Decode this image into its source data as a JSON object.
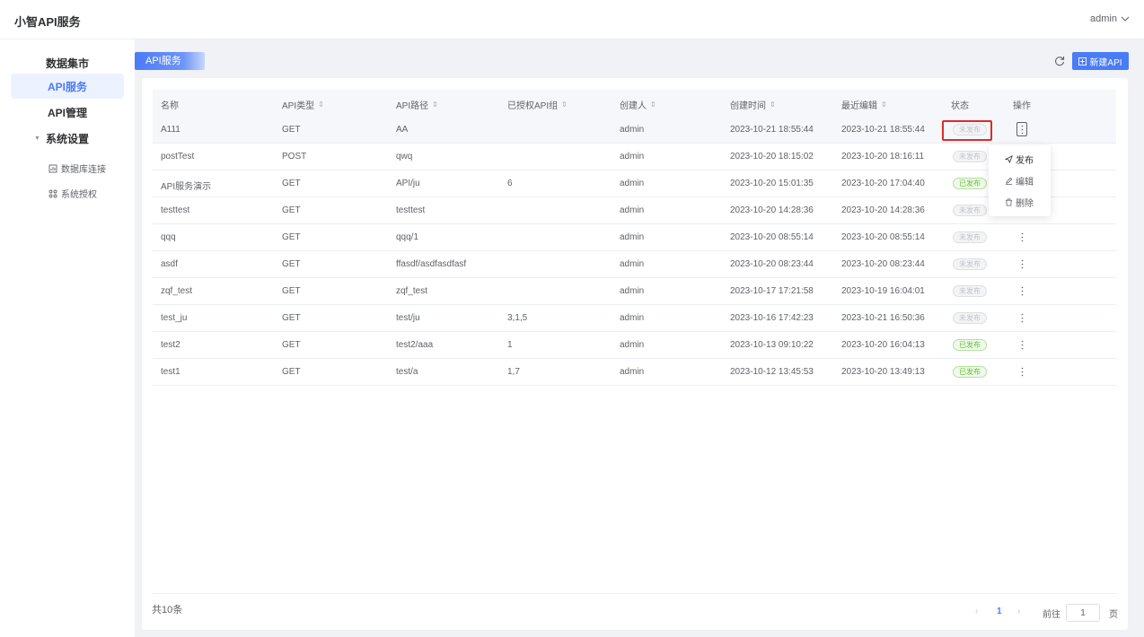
{
  "header": {
    "title": "小智API服务",
    "user": "admin"
  },
  "sidebar": {
    "items": [
      {
        "label": "数据集市"
      },
      {
        "label": "API服务"
      },
      {
        "label": "API管理"
      }
    ],
    "group": {
      "label": "系统设置",
      "children": [
        {
          "label": "数据库连接",
          "icon": "database-icon"
        },
        {
          "label": "系统授权",
          "icon": "authorize-icon"
        }
      ]
    }
  },
  "page": {
    "tab": "API服务",
    "new_button": "新建API"
  },
  "table": {
    "columns": [
      "名称",
      "API类型",
      "API路径",
      "已授权API组",
      "创建人",
      "创建时间",
      "最近编辑",
      "状态",
      "操作"
    ],
    "rows": [
      {
        "name": "A111",
        "type": "GET",
        "path": "AA",
        "groups": "",
        "creator": "admin",
        "created": "2023-10-21 18:55:44",
        "edited": "2023-10-21 18:55:44",
        "status": "未发布"
      },
      {
        "name": "postTest",
        "type": "POST",
        "path": "qwq",
        "groups": "",
        "creator": "admin",
        "created": "2023-10-20 18:15:02",
        "edited": "2023-10-20 18:16:11",
        "status": "未发布"
      },
      {
        "name": "API服务演示",
        "type": "GET",
        "path": "API/ju",
        "groups": "6",
        "creator": "admin",
        "created": "2023-10-20 15:01:35",
        "edited": "2023-10-20 17:04:40",
        "status": "已发布"
      },
      {
        "name": "testtest",
        "type": "GET",
        "path": "testtest",
        "groups": "",
        "creator": "admin",
        "created": "2023-10-20 14:28:36",
        "edited": "2023-10-20 14:28:36",
        "status": "未发布"
      },
      {
        "name": "qqq",
        "type": "GET",
        "path": "qqq/1",
        "groups": "",
        "creator": "admin",
        "created": "2023-10-20 08:55:14",
        "edited": "2023-10-20 08:55:14",
        "status": "未发布"
      },
      {
        "name": "asdf",
        "type": "GET",
        "path": "ffasdf/asdfasdfasf",
        "groups": "",
        "creator": "admin",
        "created": "2023-10-20 08:23:44",
        "edited": "2023-10-20 08:23:44",
        "status": "未发布"
      },
      {
        "name": "zqf_test",
        "type": "GET",
        "path": "zqf_test",
        "groups": "",
        "creator": "admin",
        "created": "2023-10-17 17:21:58",
        "edited": "2023-10-19 16:04:01",
        "status": "未发布"
      },
      {
        "name": "test_ju",
        "type": "GET",
        "path": "test/ju",
        "groups": "3,1,5",
        "creator": "admin",
        "created": "2023-10-16 17:42:23",
        "edited": "2023-10-21 16:50:36",
        "status": "未发布"
      },
      {
        "name": "test2",
        "type": "GET",
        "path": "test2/aaa",
        "groups": "1",
        "creator": "admin",
        "created": "2023-10-13 09:10:22",
        "edited": "2023-10-20 16:04:13",
        "status": "已发布"
      },
      {
        "name": "test1",
        "type": "GET",
        "path": "test/a",
        "groups": "1,7",
        "creator": "admin",
        "created": "2023-10-12 13:45:53",
        "edited": "2023-10-20 13:49:13",
        "status": "已发布"
      }
    ]
  },
  "menu": {
    "publish": "发布",
    "edit": "编辑",
    "delete": "删除"
  },
  "pagination": {
    "total": "共10条",
    "current": "1",
    "goto": "前往",
    "input": "1",
    "suffix": "页"
  },
  "colors": {
    "accent": "#4a7cf6",
    "published": "#67c23a",
    "highlight": "#e02a2a"
  }
}
